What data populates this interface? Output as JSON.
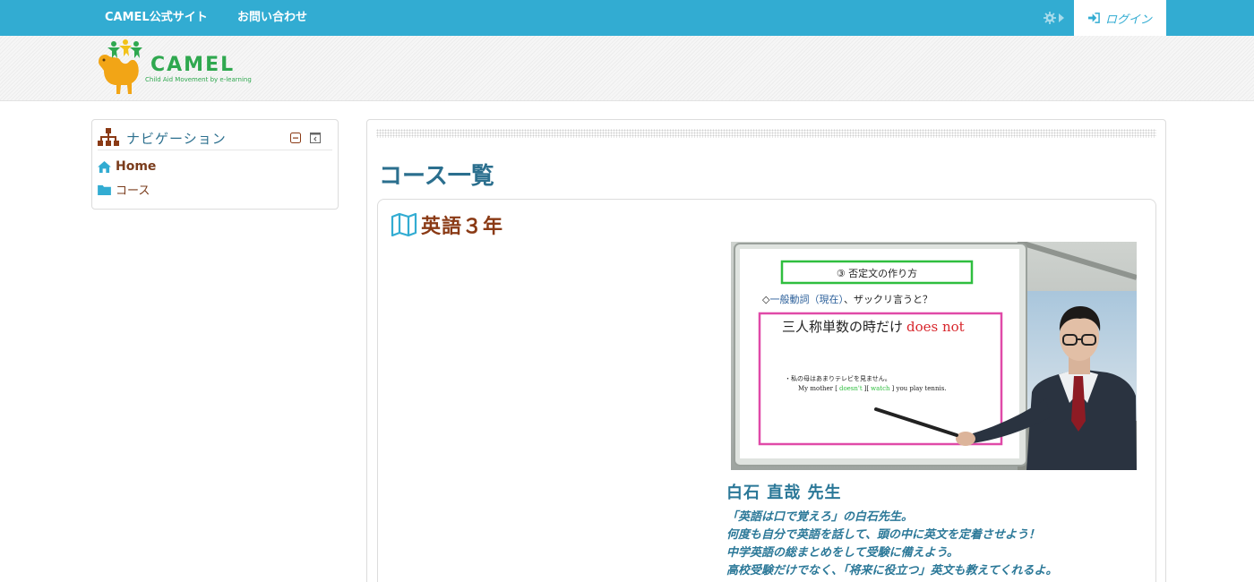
{
  "topbar": {
    "links": [
      "CAMEL公式サイト",
      "お問い合わせ"
    ],
    "login_label": "ログイン",
    "bg_color": "#32acd2"
  },
  "logo": {
    "name": "CAMEL",
    "tagline": "Child Aid Movement by e-learning"
  },
  "navigation": {
    "title": "ナビゲーション",
    "items": [
      {
        "label": "Home",
        "icon": "home-icon"
      },
      {
        "label": "コース",
        "icon": "folder-icon"
      }
    ]
  },
  "main": {
    "page_title": "コース一覧",
    "course": {
      "name": "英語３年",
      "icon": "map-icon",
      "slide": {
        "section_title": "③ 否定文の作り方",
        "question_prefix": "◇",
        "question_term": "一般動詞（現在）",
        "question_rest": "、ザックリ言うと？",
        "rule_jp": "三人称単数の時だけ",
        "rule_en": "does not",
        "example_jp": "・私の母はあまりテレビを見ません。",
        "example_en_start": "My mother [",
        "example_en_neg": "doesn't",
        "example_en_mid": "][",
        "example_en_verb": "watch",
        "example_en_end": "] you play tennis."
      },
      "teacher": "白石 直哉 先生",
      "description": [
        "「英語は口で覚えろ」の白石先生。",
        "何度も自分で英語を話して、頭の中に英文を定着させよう！",
        "中学英語の総まとめをして受験に備えよう。",
        "高校受験だけでなく、「将来に役立つ」英文も教えてくれるよ。"
      ]
    }
  },
  "colors": {
    "accent": "#32acd2",
    "title_blue": "#2b6f8e",
    "course_brown": "#8a3a15"
  }
}
